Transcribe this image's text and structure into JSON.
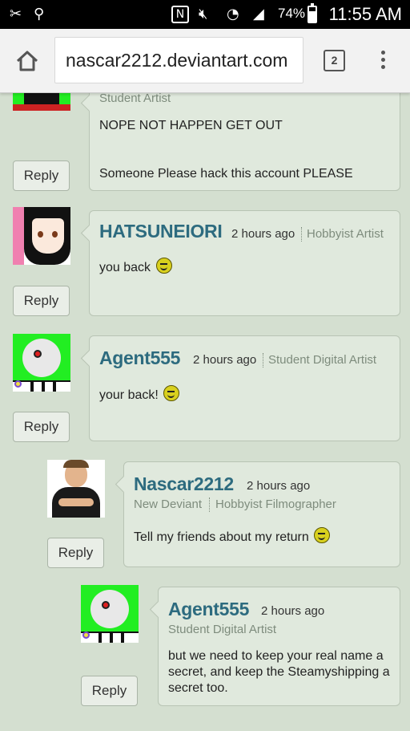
{
  "status_bar": {
    "battery": "74%",
    "time": "11:55 AM"
  },
  "browser": {
    "url": "nascar2212.deviantart.com",
    "tab_count": "2"
  },
  "comments": [
    {
      "role": "Student Artist",
      "text_lines": [
        "NOPE NOT HAPPEN GET OUT",
        "Someone Please hack this account PLEASE"
      ],
      "reply_label": "Reply"
    },
    {
      "username": "HATSUNEIORI",
      "time": "2 hours ago",
      "role": "Hobbyist Artist",
      "text": "you back",
      "reply_label": "Reply"
    },
    {
      "username": "Agent555",
      "time": "2 hours ago",
      "role": "Student Digital Artist",
      "text": "your back!",
      "reply_label": "Reply"
    },
    {
      "username": "Nascar2212",
      "time": "2 hours ago",
      "role_primary": "New Deviant",
      "role_secondary": "Hobbyist Filmographer",
      "text": "Tell my friends about my return",
      "reply_label": "Reply"
    },
    {
      "username": "Agent555",
      "time": "2 hours ago",
      "role": "Student Digital Artist",
      "text": "but we need to keep your real name a secret, and keep the Steamyshipping a secret too.",
      "reply_label": "Reply"
    }
  ]
}
